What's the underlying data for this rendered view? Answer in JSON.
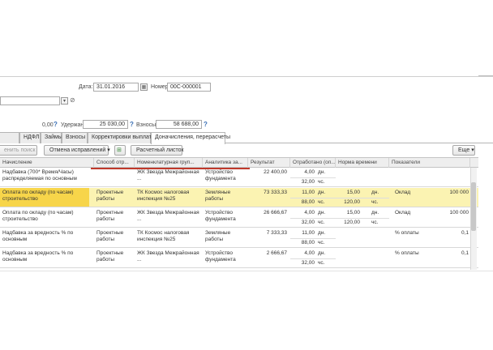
{
  "header": {
    "date_label": "Дата:",
    "date_value": "31.01.2016",
    "number_label": "Номер:",
    "number_value": "00С-000001",
    "link_icon": "link-icon",
    "deducted_label": "Удержано:",
    "deducted_value": "25 030,00",
    "contrib_label": "Взносы:",
    "contrib_value": "58 688,00",
    "left_value": "0,00"
  },
  "tabs": [
    "НДФЛ",
    "Займы",
    "Взносы",
    "Корректировки выплаты",
    "Доначисления, перерасчеты"
  ],
  "toolbar": {
    "search_cancel": "енить поиск",
    "corrections": "Отмена исправлений",
    "payslip": "Расчетный листок",
    "more": "Еще"
  },
  "columns": [
    "Начисление",
    "Способ отр...",
    "Номенклатурная груп...",
    "Аналитика за...",
    "Результат",
    "Отработано (оп...",
    "Норма времени",
    "Показатели"
  ],
  "rows": [
    {
      "name": "Надбавка (700* Время/Часы) распределяемая по основным",
      "method": "",
      "nomen": "ЖК Звезда Межрайонная ...",
      "analytics": "Устройство фундамента",
      "result": "22 400,00",
      "worked1": "4,00",
      "unit1": "дн.",
      "worked2": "32,00",
      "unit2": "чс.",
      "norm1": "",
      "norm_unit1": "",
      "norm2": "",
      "norm_unit2": "",
      "indicator": "",
      "ind_value": ""
    },
    {
      "name": "Оплата по окладу (по часам) строительство",
      "method": "Проектные работы",
      "nomen": "ТК Космос налоговая инспекция №25",
      "analytics": "Земляные работы",
      "result": "73 333,33",
      "worked1": "11,00",
      "unit1": "дн.",
      "worked2": "88,00",
      "unit2": "чс.",
      "norm1": "15,00",
      "norm_unit1": "дн.",
      "norm2": "120,00",
      "norm_unit2": "чс.",
      "indicator": "Оклад",
      "ind_value": "100 000"
    },
    {
      "name": "Оплата по окладу (по часам) строительство",
      "method": "Проектные работы",
      "nomen": "ЖК Звезда Межрайонная ...",
      "analytics": "Устройство фундамента",
      "result": "26 666,67",
      "worked1": "4,00",
      "unit1": "дн.",
      "worked2": "32,00",
      "unit2": "чс.",
      "norm1": "15,00",
      "norm_unit1": "дн.",
      "norm2": "120,00",
      "norm_unit2": "чс.",
      "indicator": "Оклад",
      "ind_value": "100 000"
    },
    {
      "name": "Надбавка за вредность % по основным",
      "method": "Проектные работы",
      "nomen": "ТК Космос налоговая инспекция №25",
      "analytics": "Земляные работы",
      "result": "7 333,33",
      "worked1": "11,00",
      "unit1": "дн.",
      "worked2": "88,00",
      "unit2": "чс.",
      "norm1": "",
      "norm_unit1": "",
      "norm2": "",
      "norm_unit2": "",
      "indicator": "% оплаты",
      "ind_value": "0,1"
    },
    {
      "name": "Надбавка за вредность % по основным",
      "method": "Проектные работы",
      "nomen": "ЖК Звезда Межрайонная ...",
      "analytics": "Устройство фундамента",
      "result": "2 666,67",
      "worked1": "4,00",
      "unit1": "дн.",
      "worked2": "32,00",
      "unit2": "чс.",
      "norm1": "",
      "norm_unit1": "",
      "norm2": "",
      "norm_unit2": "",
      "indicator": "% оплаты",
      "ind_value": "0,1"
    }
  ],
  "colors": {
    "selected_row": "#fbf3b2",
    "selected_cell": "#f7d54a",
    "red_underline": "#c0392b",
    "help_mark": "#3a6fb5"
  }
}
